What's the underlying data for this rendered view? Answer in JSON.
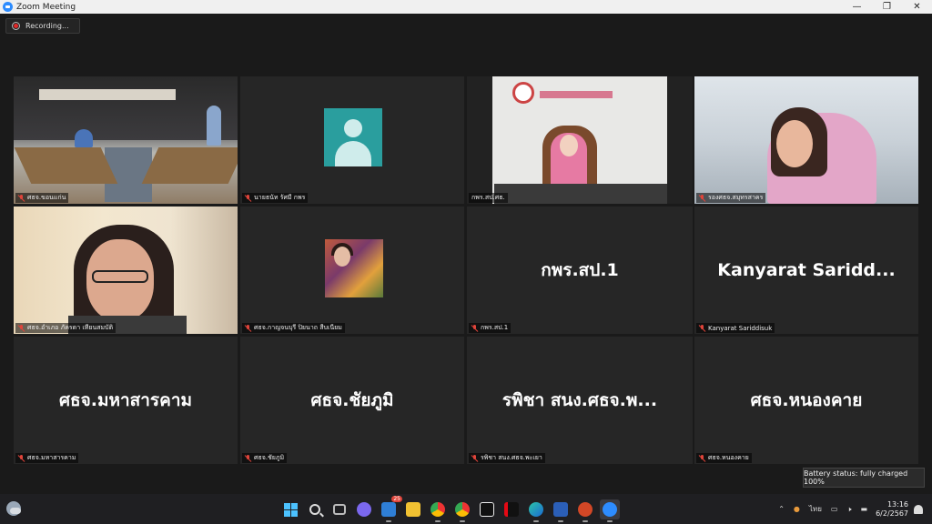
{
  "window": {
    "title": "Zoom Meeting",
    "controls": [
      "—",
      "❐",
      "✕"
    ]
  },
  "recording": {
    "label": "Recording..."
  },
  "tiles": [
    {
      "name": "ศธจ.ขอนแก่น"
    },
    {
      "name": "นายธนัท รัศมี กพร"
    },
    {
      "name": "กพร.สป.ศธ."
    },
    {
      "name": "รองศธจ.สมุทรสาคร"
    },
    {
      "name": "ศธจ.อำเภอ ภัครดา เทียนสมบัติ"
    },
    {
      "name": "ศธจ.กาญจนบุรี ปิยนาถ สืบเนียม"
    },
    {
      "name": "กพร.สป.1",
      "display": "กพร.สป.1"
    },
    {
      "name": "Kanyarat Sariddisuk",
      "display": "Kanyarat  Saridd..."
    },
    {
      "name": "ศธจ.มหาสารคาม",
      "display": "ศธจ.มหาสารคาม"
    },
    {
      "name": "ศธจ.ชัยภูมิ",
      "display": "ศธจ.ชัยภูมิ"
    },
    {
      "name": "รพิชา สนง.ศธจ.พะเยา",
      "display": "รพิชา สนง.ศธจ.พ..."
    },
    {
      "name": "ศธจ.หนองคาย",
      "display": "ศธจ.หนองคาย"
    }
  ],
  "tooltip": {
    "battery": "Battery status: fully charged 100%"
  },
  "taskbar": {
    "mail_badge": "25",
    "tray_lang": "ไทย",
    "clock_time": "13:16",
    "clock_date": "6/2/2567"
  }
}
